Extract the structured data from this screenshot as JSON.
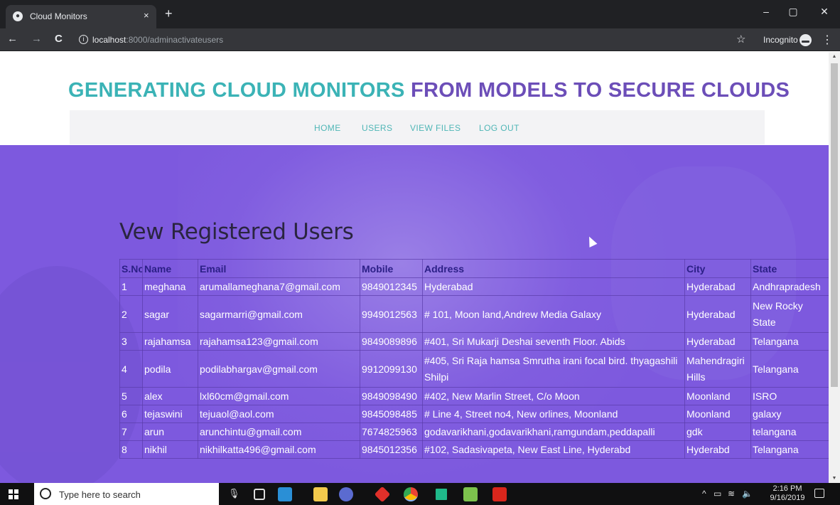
{
  "browser": {
    "tab_title": "Cloud Monitors",
    "tab_close": "×",
    "new_tab": "+",
    "minimize": "–",
    "restore": "▢",
    "close": "✕",
    "back": "←",
    "forward": "→",
    "reload": "C",
    "info": "i",
    "url_host": "localhost",
    "url_path": ":8000/adminactivateusers",
    "star": "☆",
    "incognito_label": "Incognito",
    "menu": "⋮"
  },
  "site": {
    "title_part1": "GENERATING CLOUD MONITORS",
    "title_part2": "FROM MODELS TO SECURE CLOUDS",
    "nav": [
      "HOME",
      "USERS",
      "VIEW FILES",
      "LOG OUT"
    ]
  },
  "main": {
    "heading": "Vew Registered Users",
    "columns": [
      "S.No",
      "Name",
      "Email",
      "Mobile",
      "Address",
      "City",
      "State"
    ],
    "rows": [
      [
        "1",
        "meghana",
        "arumallameghana7@gmail.com",
        "9849012345",
        "Hyderabad",
        "Hyderabad",
        "Andhrapradesh"
      ],
      [
        "2",
        "sagar",
        "sagarmarri@gmail.com",
        "9949012563",
        "# 101, Moon land,Andrew Media Galaxy",
        "Hyderabad",
        "New Rocky State"
      ],
      [
        "3",
        "rajahamsa",
        "rajahamsa123@gmail.com",
        "9849089896",
        "#401, Sri Mukarji Deshai seventh Floor. Abids",
        "Hyderabad",
        "Telangana"
      ],
      [
        "4",
        "podila",
        "podilabhargav@gmail.com",
        "9912099130",
        "#405, Sri Raja hamsa Smrutha irani focal bird. thyagashili Shilpi",
        "Mahendragiri Hills",
        "Telangana"
      ],
      [
        "5",
        "alex",
        "lxl60cm@gmail.com",
        "9849098490",
        "#402, New Marlin Street, C/o Moon",
        "Moonland",
        "ISRO"
      ],
      [
        "6",
        "tejaswini",
        "tejuaol@aol.com",
        "9845098485",
        "# Line 4, Street no4, New orlines, Moonland",
        "Moonland",
        "galaxy"
      ],
      [
        "7",
        "arun",
        "arunchintu@gmail.com",
        "7674825963",
        "godavarikhani,godavarikhani,ramgundam,peddapalli",
        "gdk",
        "telangana"
      ],
      [
        "8",
        "nikhil",
        "nikhilkatta496@gmail.com",
        "9845012356",
        "#102, Sadasivapeta, New East Line, Hyderabd",
        "Hyderabd",
        "Telangana"
      ]
    ]
  },
  "taskbar": {
    "search_placeholder": "Type here to search",
    "time": "2:16 PM",
    "date": "9/16/2019"
  },
  "colors": {
    "title_teal": "#3bb3b6",
    "title_purple": "#6c4eb8",
    "hero_purple": "#7d59de",
    "header_text": "#2b1f86"
  }
}
